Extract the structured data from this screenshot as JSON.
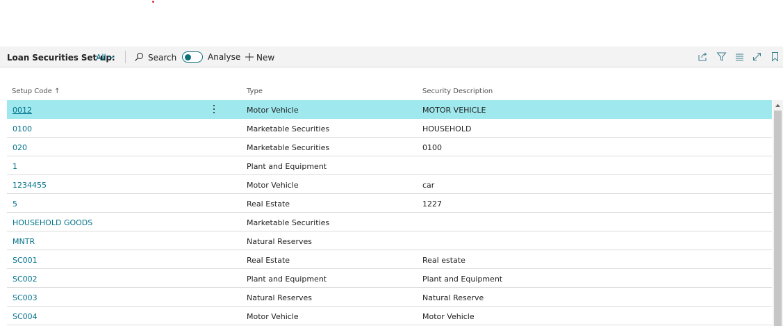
{
  "toolbar": {
    "title": "Loan Securities Set-up:",
    "filter_label": "All",
    "search_label": "Search",
    "analyse_label": "Analyse",
    "new_label": "New",
    "icons": [
      "share-icon",
      "filter-icon",
      "list-view-icon",
      "expand-icon",
      "bookmark-icon"
    ]
  },
  "columns": {
    "setup_code": "Setup Code",
    "setup_code_sort": "↑",
    "type": "Type",
    "description": "Security Description"
  },
  "rows": [
    {
      "code": "0012",
      "type": "Motor Vehicle",
      "desc": "MOTOR VEHICLE"
    },
    {
      "code": "0100",
      "type": "Marketable Securities",
      "desc": "HOUSEHOLD"
    },
    {
      "code": "020",
      "type": "Marketable Securities",
      "desc": "0100"
    },
    {
      "code": "1",
      "type": "Plant and Equipment",
      "desc": ""
    },
    {
      "code": "1234455",
      "type": "Motor Vehicle",
      "desc": "car"
    },
    {
      "code": "5",
      "type": "Real Estate",
      "desc": "1227"
    },
    {
      "code": "HOUSEHOLD GOODS",
      "type": "Marketable Securities",
      "desc": ""
    },
    {
      "code": "MNTR",
      "type": "Natural Reserves",
      "desc": ""
    },
    {
      "code": "SC001",
      "type": "Real Estate",
      "desc": "Real estate"
    },
    {
      "code": "SC002",
      "type": "Plant and Equipment",
      "desc": "Plant and Equipment"
    },
    {
      "code": "SC003",
      "type": "Natural Reserves",
      "desc": "Natural Reserve"
    },
    {
      "code": "SC004",
      "type": "Motor Vehicle",
      "desc": "Motor Vehicle"
    }
  ],
  "colors": {
    "accent": "#00718a",
    "selected_row": "#9ee8ee",
    "toolbar_bg": "#f3f3f3"
  }
}
